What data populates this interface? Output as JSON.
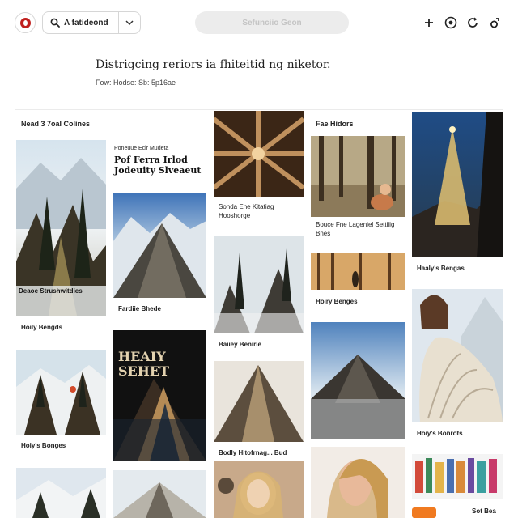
{
  "topbar": {
    "search_text": "A fatideond",
    "center_button_label": "Sefunciio Geon",
    "icons": [
      "logo-icon",
      "search-icon",
      "chevron-down-icon",
      "plus-icon",
      "notifications-icon",
      "refresh-icon",
      "account-icon"
    ]
  },
  "header": {
    "title": "Distrigcing reriors ia fhiteitid ng niketor.",
    "subtitle": "Fow: Hodse: Sb: 5p16ae"
  },
  "columns": {
    "col1_label": "Nead 3 7oal Colines",
    "col4_label": "Fae Hidors"
  },
  "tiles": {
    "t1_overlay": "Deaoe Strushwitdies",
    "t1_caption": "Hoily Bengds",
    "t2_small": "Poneuue Eclr Mudeta",
    "t2_title": "Pof Ferra Irlod Jodeuity Slveaeut",
    "t3_caption": "Fardiie Bhede",
    "t4_caption": "Hoiy's Bonges",
    "t5_caption": "Sonda Ehe Kitatiag Hooshorge",
    "t6_caption": "Baiiey Benirle",
    "t7_poster_text": "HEAIY SEHET",
    "t8_caption": "Bodly Hitofrnag... Bud",
    "t9_caption": "Bouce Fne Lageniel Settiiig Bnes",
    "t10_caption": "Hoiry Benges",
    "t11_caption": "Haaly's Bengas",
    "t12_caption": "Hoiy's Bonrots",
    "t13_caption": "Sot Bea"
  },
  "colors": {
    "brand_red": "#c0201e",
    "accent_orange": "#f07a20"
  }
}
